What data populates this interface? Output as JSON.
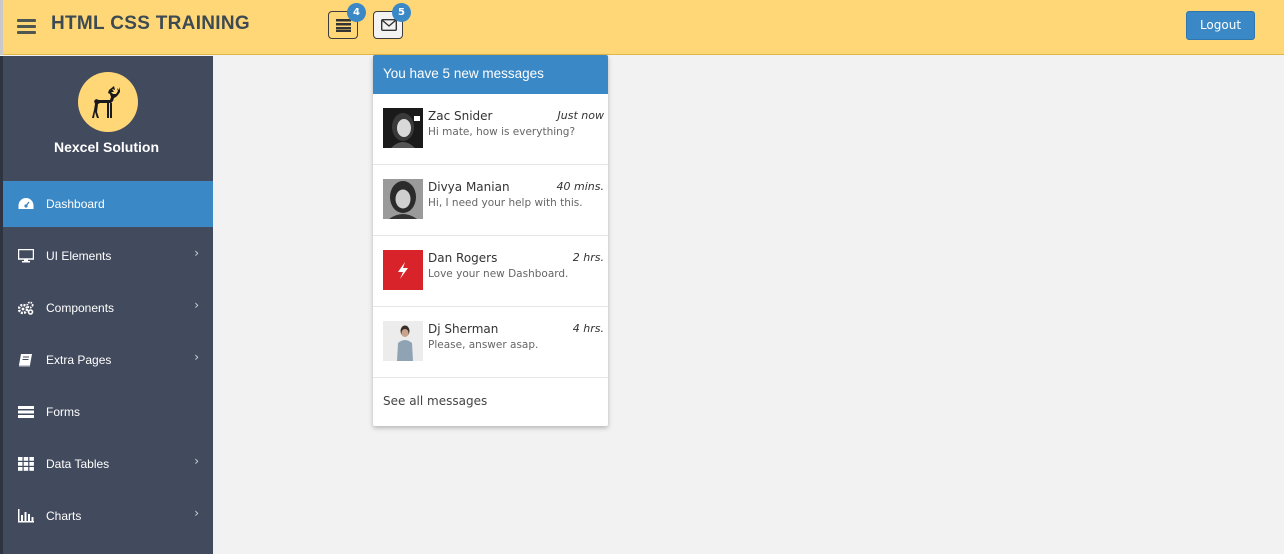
{
  "header": {
    "brand": "HTML CSS TRAINING",
    "tasks_badge": "4",
    "messages_badge": "5",
    "logout_label": "Logout",
    "colors": {
      "bar": "#ffd777",
      "accent": "#3a88c6"
    }
  },
  "sidebar": {
    "org_name": "Nexcel Solution",
    "items": [
      {
        "label": "Dashboard",
        "icon": "dashboard-icon",
        "chevron": ""
      },
      {
        "label": "UI Elements",
        "icon": "desktop-icon",
        "chevron": "›"
      },
      {
        "label": "Components",
        "icon": "cogs-icon",
        "chevron": "›"
      },
      {
        "label": "Extra Pages",
        "icon": "book-icon",
        "chevron": "›"
      },
      {
        "label": "Forms",
        "icon": "tasks-icon",
        "chevron": ""
      },
      {
        "label": "Data Tables",
        "icon": "th-icon",
        "chevron": "›"
      },
      {
        "label": "Charts",
        "icon": "bar-chart-icon",
        "chevron": "›"
      }
    ]
  },
  "messages": {
    "heading": "You have 5 new messages",
    "items": [
      {
        "name": "Zac Snider",
        "time": "Just now",
        "text": "Hi mate, how is everything?"
      },
      {
        "name": "Divya Manian",
        "time": "40 mins.",
        "text": "Hi, I need your help with this."
      },
      {
        "name": "Dan Rogers",
        "time": "2 hrs.",
        "text": "Love your new Dashboard."
      },
      {
        "name": "Dj Sherman",
        "time": "4 hrs.",
        "text": "Please, answer asap."
      }
    ],
    "see_all": "See all messages"
  }
}
